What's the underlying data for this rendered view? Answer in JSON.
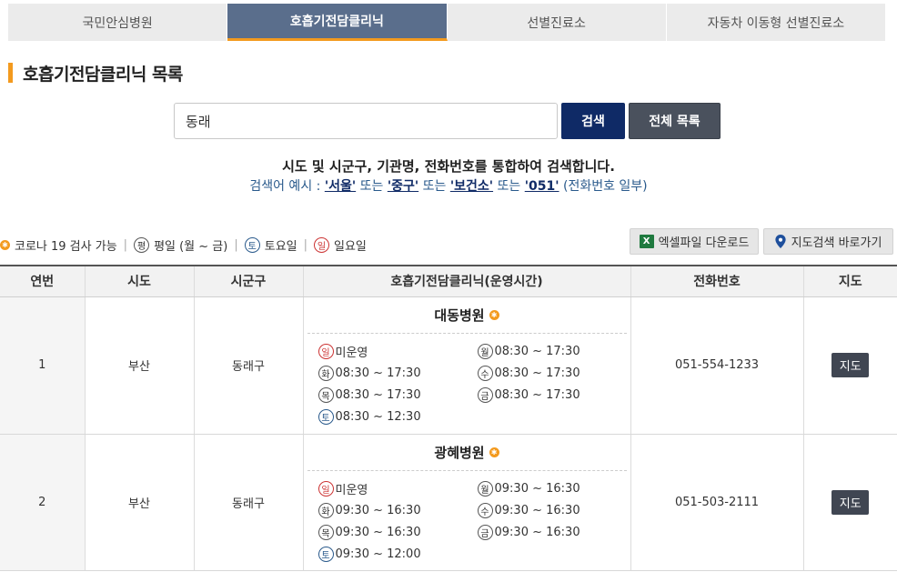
{
  "tabs": [
    "국민안심병원",
    "호흡기전담클리닉",
    "선별진료소",
    "자동차 이동형 선별진료소"
  ],
  "title": "호흡기전담클리닉 목록",
  "search": {
    "value": "동래",
    "button": "검색",
    "all_button": "전체 목록"
  },
  "guide": {
    "line1": "시도 및 시군구, 기관명, 전화번호를 통합하여 검색합니다.",
    "prefix": "검색어 예시 : ",
    "ex1": "'서울'",
    "or1": " 또는 ",
    "ex2": "'중구'",
    "or2": " 또는 ",
    "ex3": "'보건소'",
    "or3": " 또는 ",
    "ex4": "'051'",
    "suffix": " (전화번호 일부)"
  },
  "legend": {
    "covid": "코로나 19 검사 가능",
    "weekday_icon": "평",
    "weekday": "평일 (월 ~ 금)",
    "sat_icon": "토",
    "sat": "토요일",
    "sun_icon": "일",
    "sun": "일요일"
  },
  "excel_button": "엑셀파일 다운로드",
  "map_search_button": "지도검색 바로가기",
  "table": {
    "headers": [
      "연번",
      "시도",
      "시군구",
      "호흡기전담클리닉(운영시간)",
      "전화번호",
      "지도"
    ],
    "rows": [
      {
        "no": "1",
        "sido": "부산",
        "sigungu": "동래구",
        "name": "대동병원",
        "hours": {
          "sun_icon": "일",
          "sun": "미운영",
          "mon_icon": "월",
          "mon": "08:30 ~ 17:30",
          "tue_icon": "화",
          "tue": "08:30 ~ 17:30",
          "wed_icon": "수",
          "wed": "08:30 ~ 17:30",
          "thu_icon": "목",
          "thu": "08:30 ~ 17:30",
          "fri_icon": "금",
          "fri": "08:30 ~ 17:30",
          "sat_icon": "토",
          "sat": "08:30 ~ 12:30"
        },
        "phone": "051-554-1233",
        "map": "지도"
      },
      {
        "no": "2",
        "sido": "부산",
        "sigungu": "동래구",
        "name": "광혜병원",
        "hours": {
          "sun_icon": "일",
          "sun": "미운영",
          "mon_icon": "월",
          "mon": "09:30 ~ 16:30",
          "tue_icon": "화",
          "tue": "09:30 ~ 16:30",
          "wed_icon": "수",
          "wed": "09:30 ~ 16:30",
          "thu_icon": "목",
          "thu": "09:30 ~ 16:30",
          "fri_icon": "금",
          "fri": "09:30 ~ 16:30",
          "sat_icon": "토",
          "sat": "09:30 ~ 12:00"
        },
        "phone": "051-503-2111",
        "map": "지도"
      }
    ]
  },
  "colors": {
    "accent": "#f39a1e",
    "active_tab": "#5a6e8c",
    "search_btn": "#0f2a66",
    "all_btn": "#4a515d",
    "sun": "#cc3333",
    "sat": "#2a5a8c"
  }
}
